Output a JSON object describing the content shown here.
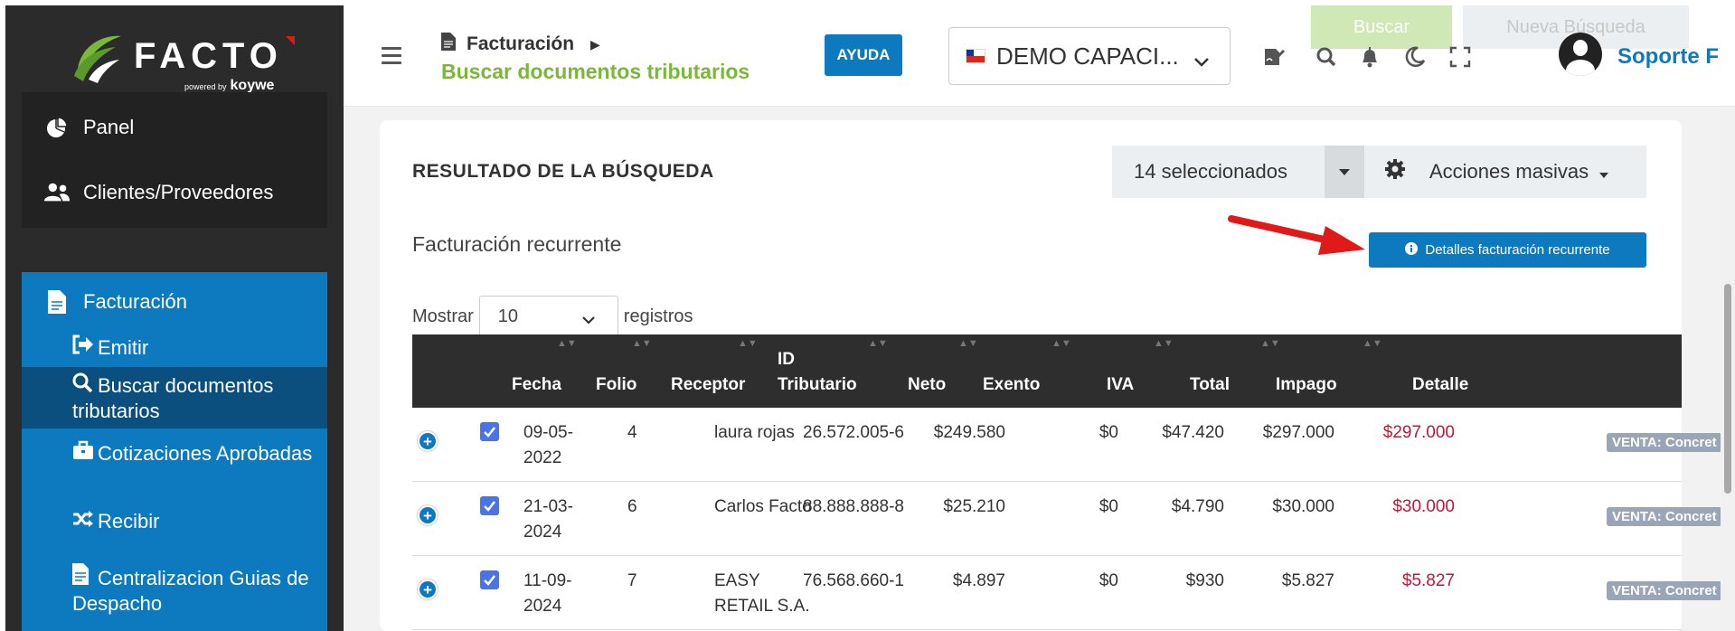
{
  "sidebar": {
    "logo": "FACTO",
    "logo_powered": "powered by",
    "logo_brand": "koywe",
    "items": [
      {
        "label": "Panel",
        "icon": "pie-chart-icon"
      },
      {
        "label": "Clientes/Proveedores",
        "icon": "users-icon"
      }
    ],
    "facturacion": {
      "label": "Facturación",
      "icon": "file-icon",
      "sub": [
        {
          "label": "Emitir",
          "icon": "sign-out-icon"
        },
        {
          "label": "Buscar documentos tributarios",
          "icon": "search-icon"
        },
        {
          "label": "Cotizaciones Aprobadas",
          "icon": "briefcase-icon"
        },
        {
          "label": "Recibir",
          "icon": "shuffle-icon"
        },
        {
          "label": "Centralizacion Guias de Despacho",
          "icon": "file-text-icon"
        }
      ]
    }
  },
  "header": {
    "breadcrumb": "Facturación",
    "page_title": "Buscar documentos tributarios",
    "help_button": "AYUDA",
    "company": "DEMO CAPACI...",
    "ghost_search": "Buscar",
    "ghost_new": "Nueva Búsqueda",
    "user": "Soporte F"
  },
  "result": {
    "title": "RESULTADO DE LA BÚSQUEDA",
    "selected": "14 seleccionados",
    "mass_actions": "Acciones masivas",
    "subtitle": "Facturación recurrente",
    "details_button": "Detalles facturación recurrente",
    "show_label": "Mostrar",
    "page_length": "10",
    "records_label": "registros"
  },
  "table": {
    "headers": {
      "fecha": "Fecha",
      "folio": "Folio",
      "receptor": "Receptor",
      "id_line1": "ID",
      "id_line2": "Tributario",
      "neto": "Neto",
      "exento": "Exento",
      "iva": "IVA",
      "total": "Total",
      "impago": "Impago",
      "detalle": "Detalle"
    },
    "rows": [
      {
        "fecha1": "09-05-",
        "fecha2": "2022",
        "folio": "4",
        "receptor1": "laura rojas",
        "receptor2": "",
        "id": "26.572.005-6",
        "neto": "$249.580",
        "exento": "$0",
        "iva": "$47.420",
        "total": "$297.000",
        "impago": "$297.000",
        "detalle": "VENTA: Concret"
      },
      {
        "fecha1": "21-03-",
        "fecha2": "2024",
        "folio": "6",
        "receptor1": "Carlos Facto",
        "receptor2": "",
        "id": "88.888.888-8",
        "neto": "$25.210",
        "exento": "$0",
        "iva": "$4.790",
        "total": "$30.000",
        "impago": "$30.000",
        "detalle": "VENTA: Concret"
      },
      {
        "fecha1": "11-09-",
        "fecha2": "2024",
        "folio": "7",
        "receptor1": "EASY",
        "receptor2": "RETAIL S.A.",
        "id": "76.568.660-1",
        "neto": "$4.897",
        "exento": "$0",
        "iva": "$930",
        "total": "$5.827",
        "impago": "$5.827",
        "detalle": "VENTA: Concret"
      }
    ]
  },
  "colors": {
    "sidebar_bg": "#2b2b2b",
    "primary": "#0d7ac0",
    "active_sub": "#0a4f7d",
    "title_green": "#7ab83a",
    "impago_red": "#c0163a",
    "arrow_red": "#e01919"
  }
}
